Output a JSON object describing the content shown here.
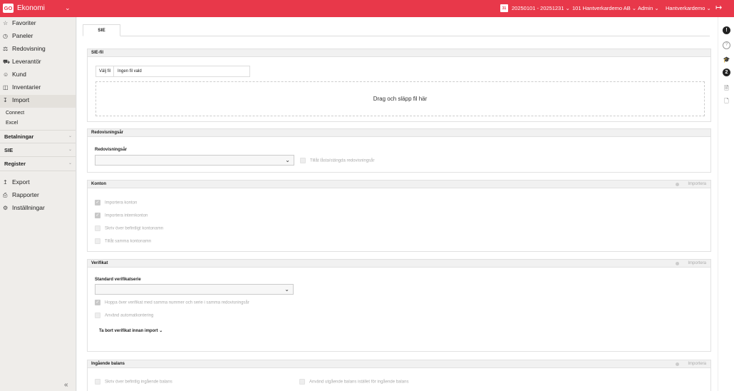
{
  "topbar": {
    "logo": "GO",
    "app_name": "Ekonomi",
    "date_range": "20250101 - 20251231 ⌄",
    "company": "101 Hantverkardemo AB ⌄",
    "role": "Admin ⌄",
    "user": "Hantverkardemo ⌄",
    "accent_color": "#e8384a"
  },
  "sidebar": {
    "items": [
      {
        "label": "Favoriter",
        "icon": "star-icon"
      },
      {
        "label": "Paneler",
        "icon": "gauge-icon"
      },
      {
        "label": "Redovisning",
        "icon": "scale-icon"
      },
      {
        "label": "Leverantör",
        "icon": "truck-icon"
      },
      {
        "label": "Kund",
        "icon": "user-icon"
      },
      {
        "label": "Inventarier",
        "icon": "inventory-icon"
      },
      {
        "label": "Import",
        "icon": "import-icon"
      }
    ],
    "import_sub": [
      "Connect",
      "Excel"
    ],
    "sections": [
      "Betalningar",
      "SIE",
      "Register"
    ],
    "bottom_items": [
      {
        "label": "Export",
        "icon": "export-icon"
      },
      {
        "label": "Rapporter",
        "icon": "print-icon"
      },
      {
        "label": "Inställningar",
        "icon": "gear-icon"
      }
    ],
    "collapse": "«"
  },
  "tabs": [
    "SIE"
  ],
  "sie_file": {
    "header": "SIE-fil",
    "choose_file": "Välj fil",
    "no_file": "Ingen fil vald",
    "drop_text": "Drag och släpp fil här"
  },
  "fiscal_year": {
    "header": "Redovisningsår",
    "label": "Redovisningsår",
    "value": "",
    "allow_closed": "Tillåt låsta/stängda redovisningsår"
  },
  "accounts": {
    "header": "Konton",
    "import_label": "Importera",
    "options": [
      {
        "label": "Importera konton",
        "checked": true
      },
      {
        "label": "Importera internkonton",
        "checked": true
      },
      {
        "label": "Skriv över befintligt kontonamn",
        "checked": false
      },
      {
        "label": "Tillåt samma kontonamn",
        "checked": false
      }
    ]
  },
  "vouchers": {
    "header": "Verifikat",
    "import_label": "Importera",
    "series_label": "Standard verifikatserie",
    "series_value": "",
    "options": [
      {
        "label": "Hoppa över verifikat med samma nummer och serie i samma redovisningsår",
        "checked": true
      },
      {
        "label": "Använd automatkontering",
        "checked": false
      }
    ],
    "remove_toggle": "Ta bort verifikat innan import"
  },
  "opening_balance": {
    "header": "Ingående balans",
    "import_label": "Importera",
    "overwrite": "Skriv över befintlig ingående balans",
    "use_outgoing": "Använd utgående balans istället för ingående balans"
  },
  "rail": {
    "icons": [
      "info-icon",
      "help-icon",
      "academy-icon",
      "notification-icon",
      "document-icon",
      "file-icon"
    ],
    "info_text": "!",
    "help_text": "?",
    "notif_text": "2"
  }
}
